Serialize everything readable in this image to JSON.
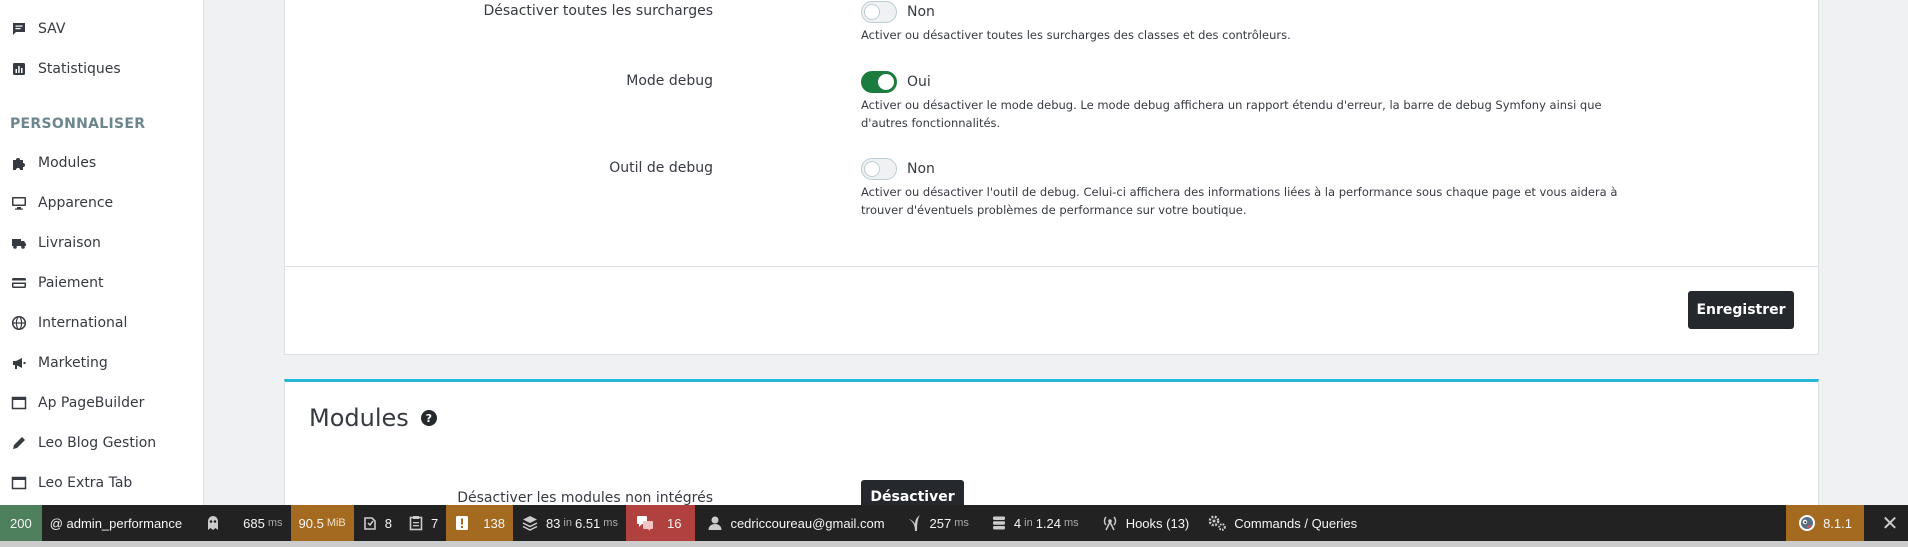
{
  "sidebar": {
    "items_top": [
      {
        "label": "SAV",
        "icon": "chat-icon"
      },
      {
        "label": "Statistiques",
        "icon": "chart-icon"
      }
    ],
    "section": "PERSONNALISER",
    "items": [
      {
        "label": "Modules",
        "icon": "puzzle-icon"
      },
      {
        "label": "Apparence",
        "icon": "monitor-icon"
      },
      {
        "label": "Livraison",
        "icon": "truck-icon"
      },
      {
        "label": "Paiement",
        "icon": "card-icon"
      },
      {
        "label": "International",
        "icon": "globe-icon"
      },
      {
        "label": "Marketing",
        "icon": "megaphone-icon"
      },
      {
        "label": "Ap PageBuilder",
        "icon": "window-icon"
      },
      {
        "label": "Leo Blog Gestion",
        "icon": "pencil-icon"
      },
      {
        "label": "Leo Extra Tab",
        "icon": "window-icon"
      }
    ]
  },
  "settings": {
    "overrides": {
      "label": "Désactiver toutes les surcharges",
      "state": "Non",
      "help": "Activer ou désactiver toutes les surcharges des classes et des contrôleurs."
    },
    "debug_mode": {
      "label": "Mode debug",
      "state": "Oui",
      "help": "Activer ou désactiver le mode debug. Le mode debug affichera un rapport étendu d'erreur, la barre de debug Symfony ainsi que d'autres fonctionnalités."
    },
    "debug_tool": {
      "label": "Outil de debug",
      "state": "Non",
      "help": "Activer ou désactiver l'outil de debug. Celui-ci affichera des informations liées à la performance sous chaque page et vous aidera à trouver d'éventuels problèmes de performance sur votre boutique."
    },
    "save_label": "Enregistrer"
  },
  "modules_card": {
    "title": "Modules",
    "help_glyph": "?",
    "row_label": "Désactiver les modules non intégrés",
    "button_label": "Désactiver"
  },
  "toolbar": {
    "status": "200",
    "route": "@ admin_performance",
    "time": "685",
    "time_unit": "ms",
    "memory": "90.5",
    "memory_unit": "MiB",
    "forms": "8",
    "validator": "7",
    "logs": "138",
    "cache": "83",
    "cache_in": "in",
    "cache_time": "6.51",
    "cache_unit": "ms",
    "translation": "16",
    "user": "cedriccoureau@gmail.com",
    "twig_time": "257",
    "twig_unit": "ms",
    "db_queries": "4",
    "db_in": "in",
    "db_time": "1.24",
    "db_unit": "ms",
    "hooks": "Hooks (13)",
    "commands": "Commands / Queries",
    "version": "8.1.1",
    "close_glyph": "✕",
    "colors": {
      "green": "#4f805d",
      "yellow": "#a46a1f",
      "red": "#b0413e",
      "bar": "#222222"
    }
  }
}
